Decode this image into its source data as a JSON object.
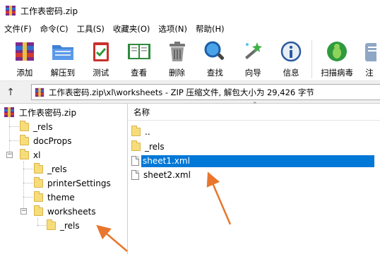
{
  "window": {
    "title": "工作表密码.zip"
  },
  "menu": [
    "文件(F)",
    "命令(C)",
    "工具(S)",
    "收藏夹(O)",
    "选项(N)",
    "帮助(H)"
  ],
  "toolbar": {
    "add": "添加",
    "extract": "解压到",
    "test": "测试",
    "view": "查看",
    "delete": "删除",
    "find": "查找",
    "wizard": "向导",
    "info": "信息",
    "virus": "扫描病毒",
    "comment": "注"
  },
  "path": {
    "text": "工作表密码.zip\\xl\\worksheets - ZIP 压缩文件, 解包大小为 29,426 字节"
  },
  "tree": {
    "root": "工作表密码.zip",
    "items": [
      "_rels",
      "docProps",
      "xl",
      "_rels",
      "printerSettings",
      "theme",
      "worksheets",
      "_rels"
    ]
  },
  "filelist": {
    "header_name": "名称",
    "rows": [
      "..",
      "_rels",
      "sheet1.xml",
      "sheet2.xml"
    ]
  },
  "colors": {
    "selection": "#0078d7",
    "arrow": "#e8762c"
  }
}
